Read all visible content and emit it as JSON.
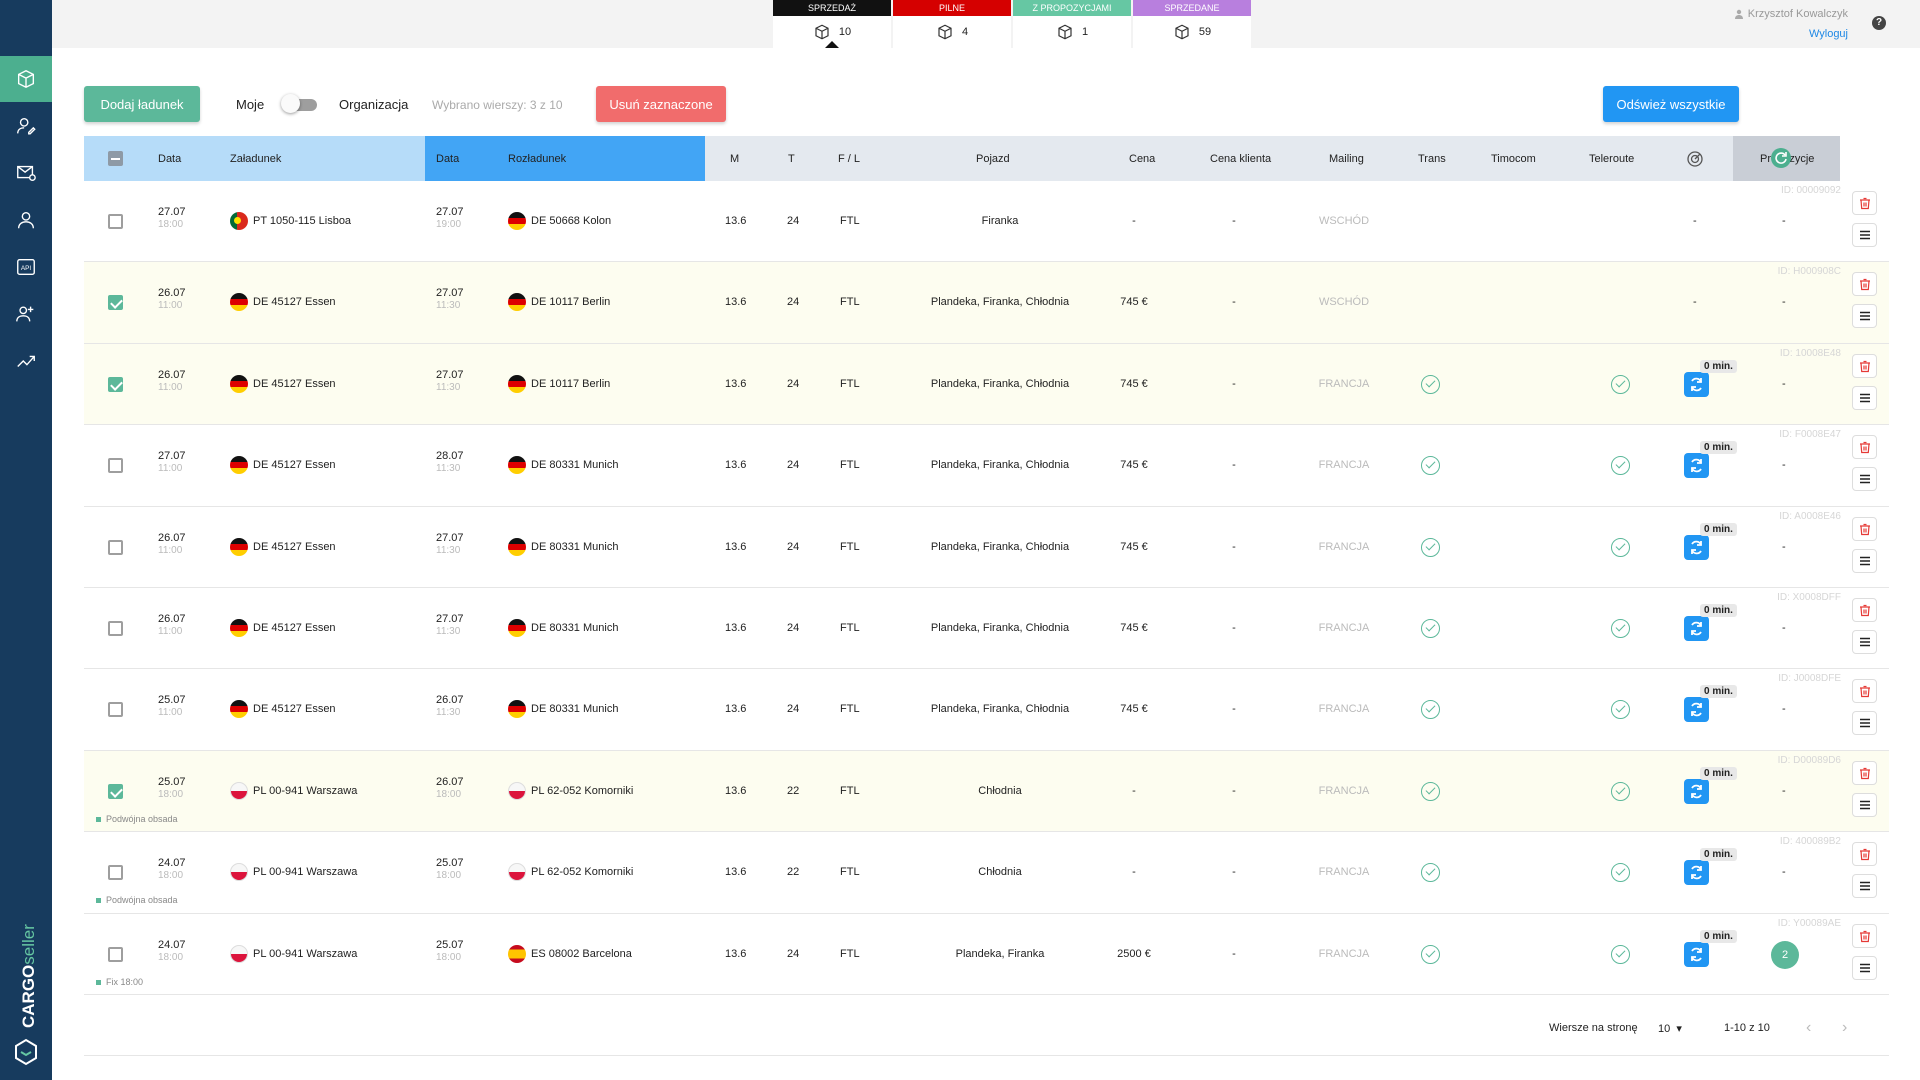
{
  "brand": "CARGOseller",
  "stats": [
    {
      "label": "SPRZEDAŻ",
      "count": "10",
      "color": "#111111"
    },
    {
      "label": "PILNE",
      "count": "4",
      "color": "#d50000"
    },
    {
      "label": "Z PROPOZYCJAMI",
      "count": "1",
      "color": "#66c7a3"
    },
    {
      "label": "SPRZEDANE",
      "count": "59",
      "color": "#b87fde"
    }
  ],
  "user": {
    "name": "Krzysztof Kowalczyk",
    "logout": "Wyloguj",
    "help": "?"
  },
  "toolbar": {
    "add": "Dodaj ładunek",
    "moje": "Moje",
    "org": "Organizacja",
    "selected": "Wybrano wierszy: 3 z 10",
    "delete": "Usuń zaznaczone",
    "refresh": "Odśwież wszystkie"
  },
  "columns": {
    "date1": "Data",
    "load": "Załadunek",
    "date2": "Data",
    "unload": "Rozładunek",
    "m": "M",
    "t": "T",
    "fl": "F / L",
    "vehicle": "Pojazd",
    "price": "Cena",
    "client_price": "Cena klienta",
    "mailing": "Mailing",
    "trans": "Trans",
    "timocom": "Timocom",
    "teleroute": "Teleroute",
    "proposals": "Propozycje"
  },
  "rows": [
    {
      "checked": false,
      "ld": "27.07",
      "lt": "18:00",
      "lflag": "pt",
      "lplace": "PT 1050-115 Lisboa",
      "ud": "27.07",
      "ut": "19:00",
      "uflag": "de",
      "uplace": "DE 50668 Kolon",
      "m": "13.6",
      "t": "24",
      "fl": "FTL",
      "vehicle": "Firanka",
      "price": "-",
      "cprice": "-",
      "mailing": "WSCHÓD",
      "trans": false,
      "tele": false,
      "sync": false,
      "syncmin": "",
      "gauge": "-",
      "prop": "-",
      "propcount": "",
      "id": "ID: 00009092",
      "note": ""
    },
    {
      "checked": true,
      "ld": "26.07",
      "lt": "11:00",
      "lflag": "de",
      "lplace": "DE 45127 Essen",
      "ud": "27.07",
      "ut": "11:30",
      "uflag": "de",
      "uplace": "DE 10117 Berlin",
      "m": "13.6",
      "t": "24",
      "fl": "FTL",
      "vehicle": "Plandeka, Firanka, Chłodnia",
      "price": "745 €",
      "cprice": "-",
      "mailing": "WSCHÓD",
      "trans": false,
      "tele": false,
      "sync": false,
      "syncmin": "",
      "gauge": "-",
      "prop": "-",
      "propcount": "",
      "id": "ID: H000908C",
      "note": ""
    },
    {
      "checked": true,
      "ld": "26.07",
      "lt": "11:00",
      "lflag": "de",
      "lplace": "DE 45127 Essen",
      "ud": "27.07",
      "ut": "11:30",
      "uflag": "de",
      "uplace": "DE 10117 Berlin",
      "m": "13.6",
      "t": "24",
      "fl": "FTL",
      "vehicle": "Plandeka, Firanka, Chłodnia",
      "price": "745 €",
      "cprice": "-",
      "mailing": "FRANCJA",
      "trans": true,
      "tele": true,
      "sync": true,
      "syncmin": "0 min.",
      "gauge": "",
      "prop": "-",
      "propcount": "",
      "id": "ID: 10008E48",
      "note": ""
    },
    {
      "checked": false,
      "ld": "27.07",
      "lt": "11:00",
      "lflag": "de",
      "lplace": "DE 45127 Essen",
      "ud": "28.07",
      "ut": "11:30",
      "uflag": "de",
      "uplace": "DE 80331 Munich",
      "m": "13.6",
      "t": "24",
      "fl": "FTL",
      "vehicle": "Plandeka, Firanka, Chłodnia",
      "price": "745 €",
      "cprice": "-",
      "mailing": "FRANCJA",
      "trans": true,
      "tele": true,
      "sync": true,
      "syncmin": "0 min.",
      "gauge": "",
      "prop": "-",
      "propcount": "",
      "id": "ID: F0008E47",
      "note": ""
    },
    {
      "checked": false,
      "ld": "26.07",
      "lt": "11:00",
      "lflag": "de",
      "lplace": "DE 45127 Essen",
      "ud": "27.07",
      "ut": "11:30",
      "uflag": "de",
      "uplace": "DE 80331 Munich",
      "m": "13.6",
      "t": "24",
      "fl": "FTL",
      "vehicle": "Plandeka, Firanka, Chłodnia",
      "price": "745 €",
      "cprice": "-",
      "mailing": "FRANCJA",
      "trans": true,
      "tele": true,
      "sync": true,
      "syncmin": "0 min.",
      "gauge": "",
      "prop": "-",
      "propcount": "",
      "id": "ID: A0008E46",
      "note": ""
    },
    {
      "checked": false,
      "ld": "26.07",
      "lt": "11:00",
      "lflag": "de",
      "lplace": "DE 45127 Essen",
      "ud": "27.07",
      "ut": "11:30",
      "uflag": "de",
      "uplace": "DE 80331 Munich",
      "m": "13.6",
      "t": "24",
      "fl": "FTL",
      "vehicle": "Plandeka, Firanka, Chłodnia",
      "price": "745 €",
      "cprice": "-",
      "mailing": "FRANCJA",
      "trans": true,
      "tele": true,
      "sync": true,
      "syncmin": "0 min.",
      "gauge": "",
      "prop": "-",
      "propcount": "",
      "id": "ID: X0008DFF",
      "note": ""
    },
    {
      "checked": false,
      "ld": "25.07",
      "lt": "11:00",
      "lflag": "de",
      "lplace": "DE 45127 Essen",
      "ud": "26.07",
      "ut": "11:30",
      "uflag": "de",
      "uplace": "DE 80331 Munich",
      "m": "13.6",
      "t": "24",
      "fl": "FTL",
      "vehicle": "Plandeka, Firanka, Chłodnia",
      "price": "745 €",
      "cprice": "-",
      "mailing": "FRANCJA",
      "trans": true,
      "tele": true,
      "sync": true,
      "syncmin": "0 min.",
      "gauge": "",
      "prop": "-",
      "propcount": "",
      "id": "ID: J0008DFE",
      "note": ""
    },
    {
      "checked": true,
      "ld": "25.07",
      "lt": "18:00",
      "lflag": "pl",
      "lplace": "PL 00-941 Warszawa",
      "ud": "26.07",
      "ut": "18:00",
      "uflag": "pl",
      "uplace": "PL 62-052 Komorniki",
      "m": "13.6",
      "t": "22",
      "fl": "FTL",
      "vehicle": "Chłodnia",
      "price": "-",
      "cprice": "-",
      "mailing": "FRANCJA",
      "trans": true,
      "tele": true,
      "sync": true,
      "syncmin": "0 min.",
      "gauge": "",
      "prop": "-",
      "propcount": "",
      "id": "ID: D00089D6",
      "note": "Podwójna obsada"
    },
    {
      "checked": false,
      "ld": "24.07",
      "lt": "18:00",
      "lflag": "pl",
      "lplace": "PL 00-941 Warszawa",
      "ud": "25.07",
      "ut": "18:00",
      "uflag": "pl",
      "uplace": "PL 62-052 Komorniki",
      "m": "13.6",
      "t": "22",
      "fl": "FTL",
      "vehicle": "Chłodnia",
      "price": "-",
      "cprice": "-",
      "mailing": "FRANCJA",
      "trans": true,
      "tele": true,
      "sync": true,
      "syncmin": "0 min.",
      "gauge": "",
      "prop": "-",
      "propcount": "",
      "id": "ID: 400089B2",
      "note": "Podwójna obsada"
    },
    {
      "checked": false,
      "ld": "24.07",
      "lt": "18:00",
      "lflag": "pl",
      "lplace": "PL 00-941 Warszawa",
      "ud": "25.07",
      "ut": "18:00",
      "uflag": "es",
      "uplace": "ES 08002 Barcelona",
      "m": "13.6",
      "t": "24",
      "fl": "FTL",
      "vehicle": "Plandeka, Firanka",
      "price": "2500 €",
      "cprice": "-",
      "mailing": "FRANCJA",
      "trans": true,
      "tele": true,
      "sync": true,
      "syncmin": "0 min.",
      "gauge": "",
      "prop": "",
      "propcount": "2",
      "id": "ID: Y00089AE",
      "note": "Fix 18:00"
    }
  ],
  "pagination": {
    "rows_label": "Wiersze na stronę",
    "rows_value": "10",
    "range": "1-10 z 10",
    "prev": "‹",
    "next": "›"
  }
}
